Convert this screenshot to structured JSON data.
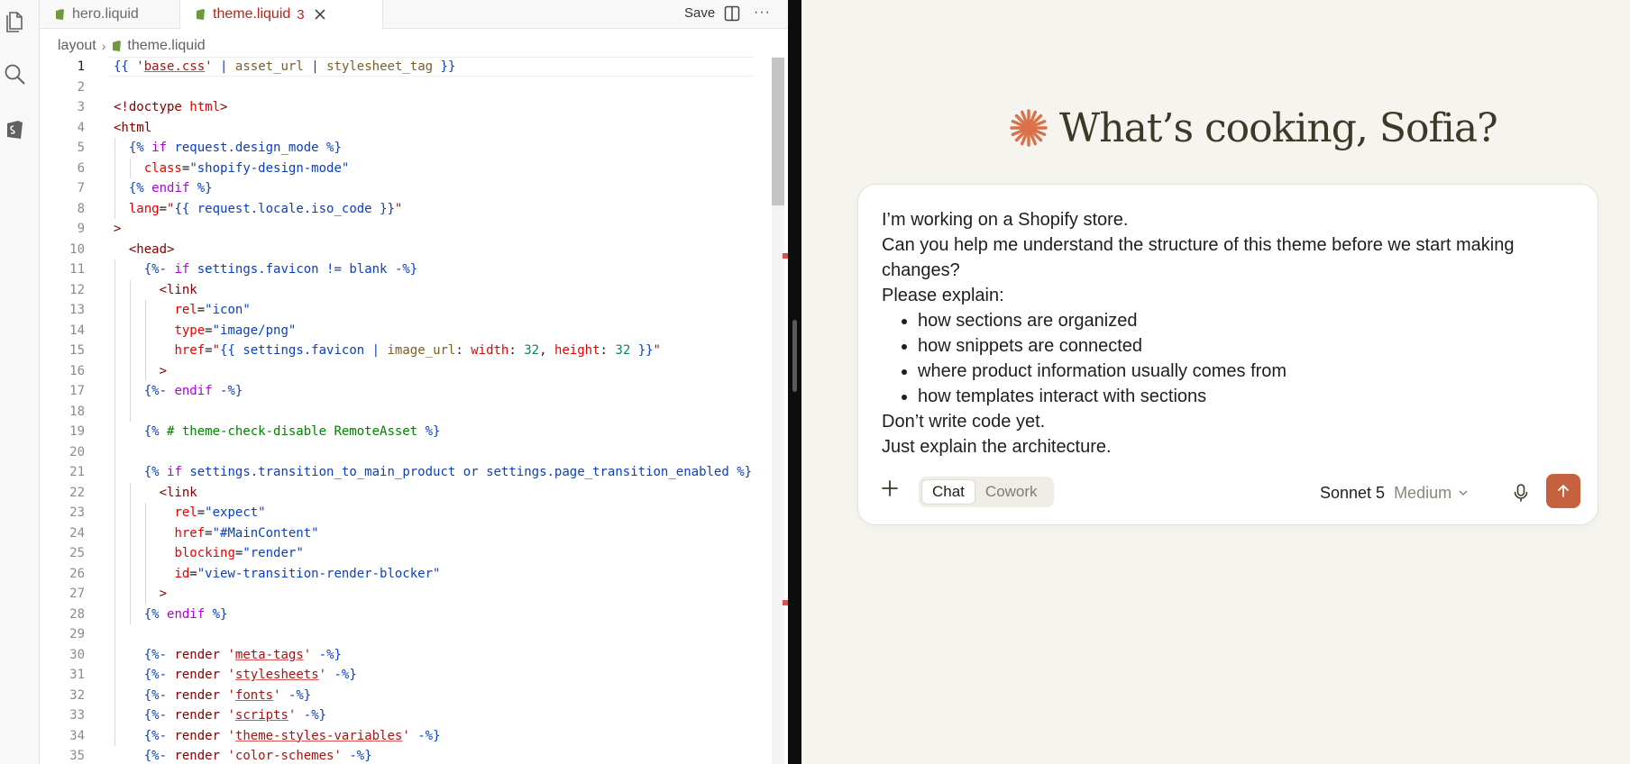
{
  "tabs": [
    {
      "label": "hero.liquid",
      "active": false
    },
    {
      "label": "theme.liquid",
      "active": true,
      "badge": "3"
    }
  ],
  "toolbar": {
    "save_label": "Save",
    "more_label": "···"
  },
  "breadcrumb": {
    "folder": "layout",
    "file": "theme.liquid"
  },
  "code_lines": [
    {
      "n": "1",
      "html": "<span class=\"k-br\">{{</span> <span class=\"k-strq\">'<span class=\"k-u\">base.css</span>'</span> <span class=\"k-br\">|</span> <span class=\"k-filt\">asset_url</span> <span class=\"k-br\">|</span> <span class=\"k-filt\">stylesheet_tag</span> <span class=\"k-br\">}}</span>"
    },
    {
      "n": "2",
      "html": ""
    },
    {
      "n": "3",
      "html": "<span class=\"k-tag\">&lt;!doctype</span> <span class=\"k-attr\">html</span><span class=\"k-tag\">&gt;</span>"
    },
    {
      "n": "4",
      "html": "<span class=\"k-tag\">&lt;html</span>"
    },
    {
      "n": "5",
      "html": "  <span class=\"k-br\">{%</span> <span class=\"k-kw\">if</span> <span class=\"k-var\">request.design_mode</span> <span class=\"k-br\">%}</span>"
    },
    {
      "n": "6",
      "html": "    <span class=\"k-attr\">class</span>=<span class=\"k-str\">\"shopify-design-mode\"</span>"
    },
    {
      "n": "7",
      "html": "  <span class=\"k-br\">{%</span> <span class=\"k-kw\">endif</span> <span class=\"k-br\">%}</span>"
    },
    {
      "n": "8",
      "html": "  <span class=\"k-attr\">lang</span>=<span class=\"k-strq\">\"</span><span class=\"k-br\">{{</span> <span class=\"k-var\">request.locale.iso_code</span> <span class=\"k-br\">}}</span><span class=\"k-strq\">\"</span>"
    },
    {
      "n": "9",
      "html": "<span class=\"k-tag\">&gt;</span>"
    },
    {
      "n": "10",
      "html": "  <span class=\"k-tag\">&lt;head&gt;</span>"
    },
    {
      "n": "11",
      "html": "    <span class=\"k-br\">{%-</span> <span class=\"k-kw\">if</span> <span class=\"k-var\">settings.favicon</span> <span class=\"k-kw2\">!=</span> <span class=\"k-var\">blank</span> <span class=\"k-br\">-%}</span>"
    },
    {
      "n": "12",
      "html": "      <span class=\"k-tag\">&lt;link</span>"
    },
    {
      "n": "13",
      "html": "        <span class=\"k-attr\">rel</span>=<span class=\"k-str\">\"icon\"</span>"
    },
    {
      "n": "14",
      "html": "        <span class=\"k-attr\">type</span>=<span class=\"k-str\">\"image/png\"</span>"
    },
    {
      "n": "15",
      "html": "        <span class=\"k-attr\">href</span>=<span class=\"k-strq\">\"</span><span class=\"k-br\">{{</span> <span class=\"k-var\">settings.favicon</span> <span class=\"k-br\">|</span> <span class=\"k-filt\">image_url</span>: <span class=\"k-attr\">width</span>: <span class=\"k-num\">32</span>, <span class=\"k-attr\">height</span>: <span class=\"k-num\">32</span> <span class=\"k-br\">}}</span><span class=\"k-strq\">\"</span>"
    },
    {
      "n": "16",
      "html": "      <span class=\"k-tag\">&gt;</span>"
    },
    {
      "n": "17",
      "html": "    <span class=\"k-br\">{%-</span> <span class=\"k-kw\">endif</span> <span class=\"k-br\">-%}</span>"
    },
    {
      "n": "18",
      "html": ""
    },
    {
      "n": "19",
      "html": "    <span class=\"k-br\">{%</span> <span class=\"k-com\"># theme-check-disable RemoteAsset</span> <span class=\"k-br\">%}</span>"
    },
    {
      "n": "20",
      "html": ""
    },
    {
      "n": "21",
      "html": "    <span class=\"k-br\">{%</span> <span class=\"k-kw\">if</span> <span class=\"k-var\">settings.transition_to_main_product</span> <span class=\"k-kw2\">or</span> <span class=\"k-var\">settings.page_transition_enabled</span> <span class=\"k-br\">%}</span>"
    },
    {
      "n": "22",
      "html": "      <span class=\"k-tag\">&lt;link</span>"
    },
    {
      "n": "23",
      "html": "        <span class=\"k-attr\">rel</span>=<span class=\"k-str\">\"expect\"</span>"
    },
    {
      "n": "24",
      "html": "        <span class=\"k-attr\">href</span>=<span class=\"k-str\">\"#MainContent\"</span>"
    },
    {
      "n": "25",
      "html": "        <span class=\"k-attr\">blocking</span>=<span class=\"k-str\">\"render\"</span>"
    },
    {
      "n": "26",
      "html": "        <span class=\"k-attr\">id</span>=<span class=\"k-str\">\"view-transition-render-blocker\"</span>"
    },
    {
      "n": "27",
      "html": "      <span class=\"k-tag\">&gt;</span>"
    },
    {
      "n": "28",
      "html": "    <span class=\"k-br\">{%</span> <span class=\"k-kw\">endif</span> <span class=\"k-br\">%}</span>"
    },
    {
      "n": "29",
      "html": ""
    },
    {
      "n": "30",
      "html": "    <span class=\"k-br\">{%-</span> <span class=\"k-tag\">render</span> <span class=\"k-strq\">'<span class=\"k-u\">meta-tags</span>'</span> <span class=\"k-br\">-%}</span>"
    },
    {
      "n": "31",
      "html": "    <span class=\"k-br\">{%-</span> <span class=\"k-tag\">render</span> <span class=\"k-strq\">'<span class=\"k-u\">stylesheets</span>'</span> <span class=\"k-br\">-%}</span>"
    },
    {
      "n": "32",
      "html": "    <span class=\"k-br\">{%-</span> <span class=\"k-tag\">render</span> <span class=\"k-strq\">'<span class=\"k-u\">fonts</span>'</span> <span class=\"k-br\">-%}</span>"
    },
    {
      "n": "33",
      "html": "    <span class=\"k-br\">{%-</span> <span class=\"k-tag\">render</span> <span class=\"k-strq\">'<span class=\"k-u\">scripts</span>'</span> <span class=\"k-br\">-%}</span>"
    },
    {
      "n": "34",
      "html": "    <span class=\"k-br\">{%-</span> <span class=\"k-tag\">render</span> <span class=\"k-strq\">'<span class=\"k-u\">theme-styles-variables</span>'</span> <span class=\"k-br\">-%}</span>"
    },
    {
      "n": "35",
      "html": "    <span class=\"k-br\">{%-</span> <span class=\"k-tag\">render</span> <span class=\"k-strq\">'color-schemes'</span> <span class=\"k-br\">-%}</span>"
    }
  ],
  "chat": {
    "greeting": "What’s cooking, Sofia?",
    "message_intro": "I’m working on a Shopify store.",
    "message_line2": "Can you help me understand the structure of this theme before we start making changes?",
    "message_line3": "Please explain:",
    "bullets": [
      "how sections are organized",
      "how snippets are connected",
      "where product information usually comes from",
      "how templates interact with sections"
    ],
    "message_line4": "Don’t write code yet.",
    "message_line5": "Just explain the architecture.",
    "modes": [
      {
        "label": "Chat",
        "active": true
      },
      {
        "label": "Cowork",
        "active": false
      }
    ],
    "model_name": "Sonnet 5",
    "model_effort": "Medium"
  },
  "colors": {
    "accent": "#c6613f",
    "greeting_text": "#3d3929",
    "error": "#d9534f"
  }
}
